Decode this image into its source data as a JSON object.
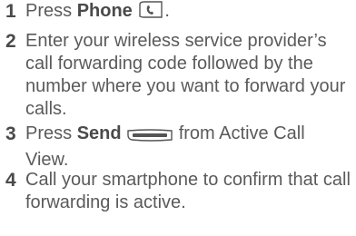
{
  "steps": [
    {
      "number": "1",
      "pre": "Press ",
      "bold": "Phone",
      "post": ".",
      "icon": "phone-key-icon"
    },
    {
      "number": "2",
      "text": "Enter your wireless service provider’s call forwarding code followed by the number where you want to forward your calls."
    },
    {
      "number": "3",
      "pre": "Press ",
      "bold": "Send",
      "post": " from Active Call View.",
      "icon": "send-key-icon"
    },
    {
      "number": "4",
      "text": "Call your smartphone to confirm that call forwarding is active."
    }
  ]
}
